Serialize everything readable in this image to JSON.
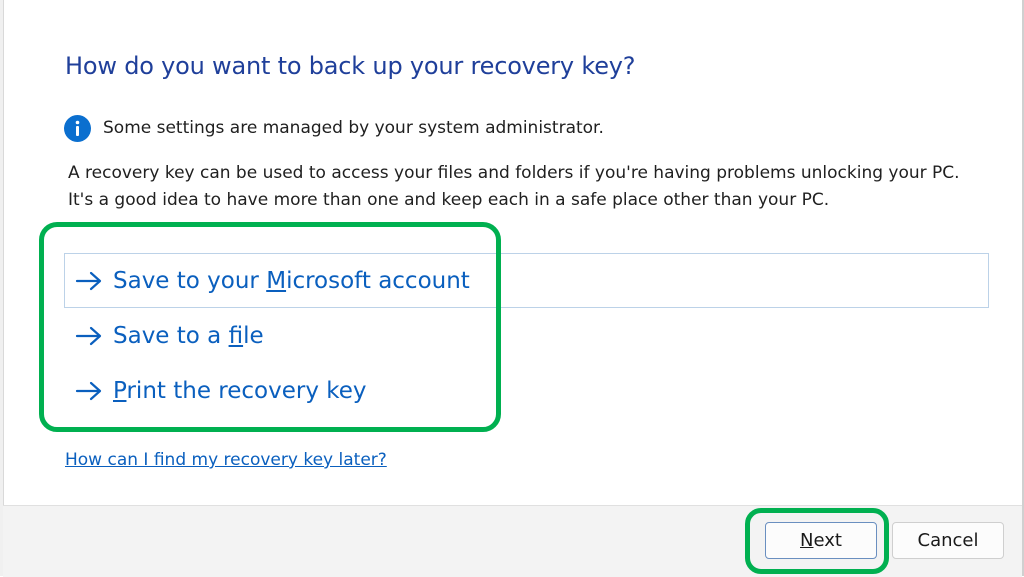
{
  "dialog": {
    "title": "How do you want to back up your recovery key?",
    "info_text": "Some settings are managed by your system administrator.",
    "description_lines": [
      "A recovery key can be used to access your files and folders if you're having problems unlocking your PC.",
      "It's a good idea to have more than one and keep each in a safe place other than your PC."
    ],
    "options": [
      {
        "pre": "Save to your ",
        "key": "M",
        "post": "icrosoft account"
      },
      {
        "pre": "Save to a ",
        "key": "f",
        "post": "ile"
      },
      {
        "pre": "",
        "key": "P",
        "post": "rint the recovery key"
      }
    ],
    "help_link": "How can I find my recovery key later?"
  },
  "footer": {
    "next": {
      "key": "N",
      "rest": "ext"
    },
    "cancel_label": "Cancel"
  },
  "colors": {
    "accent": "#0a5fbe",
    "title": "#1f3f9a",
    "highlight": "#00b050"
  }
}
